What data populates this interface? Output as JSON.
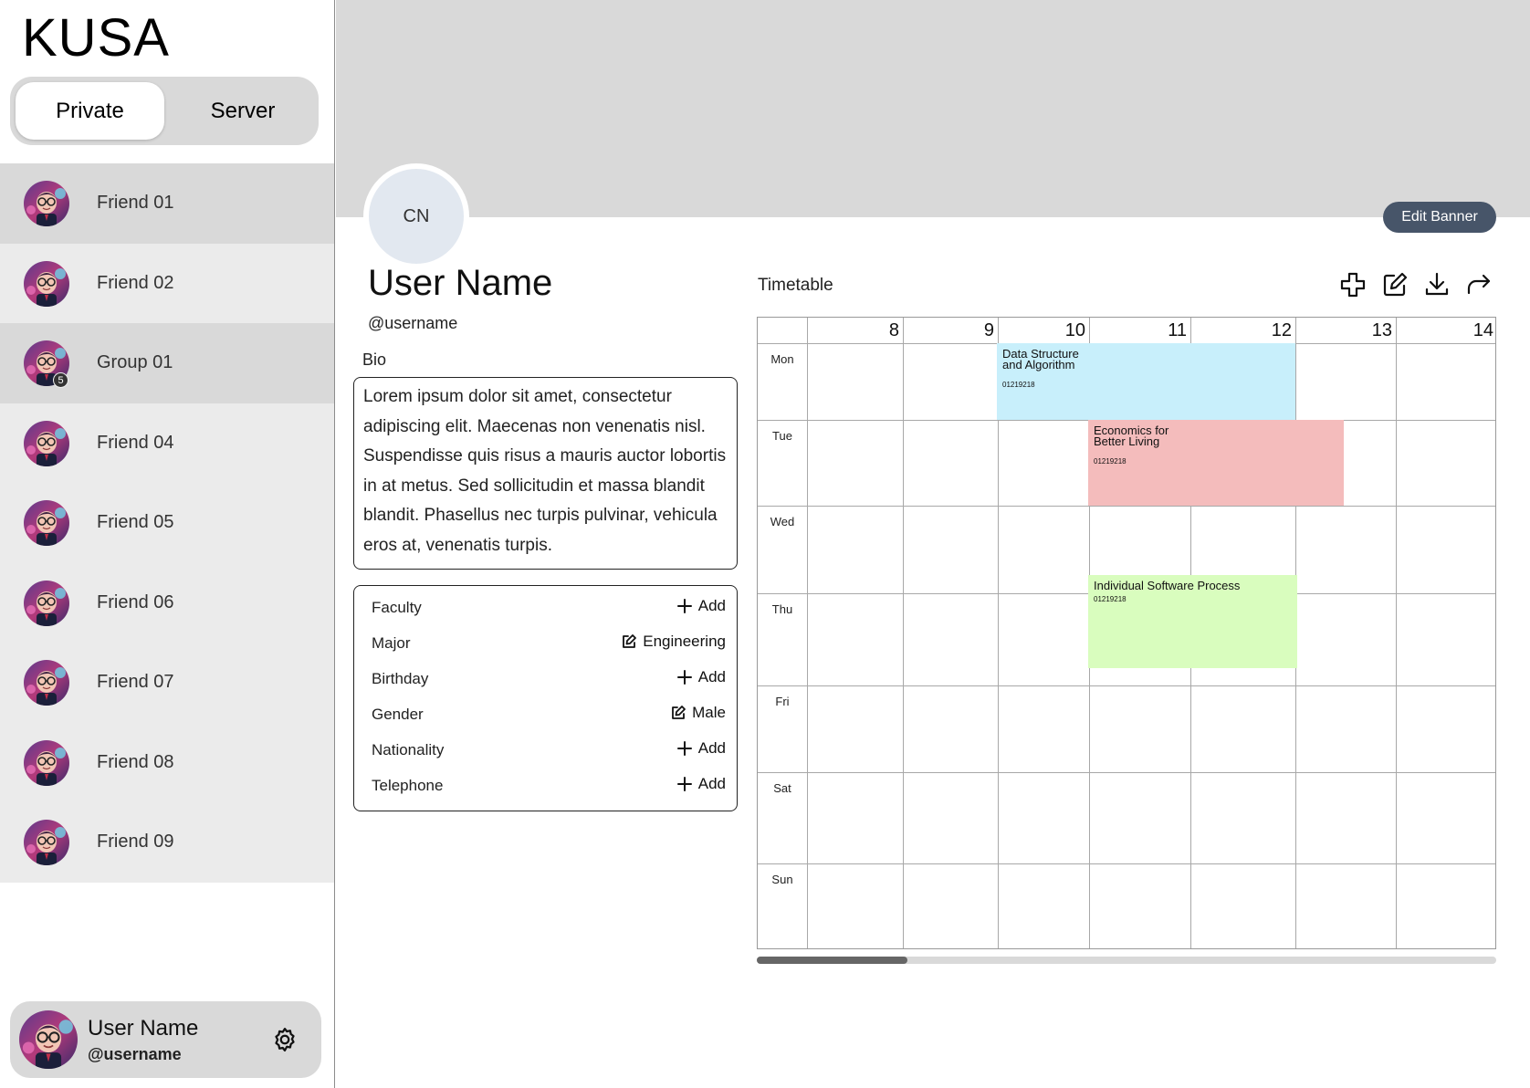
{
  "app": {
    "logo": "KUSA"
  },
  "segments": {
    "private": "Private",
    "server": "Server"
  },
  "friends": [
    {
      "name": "Friend 01"
    },
    {
      "name": "Friend 02"
    },
    {
      "name": "Group 01",
      "badge": "5"
    },
    {
      "name": "Friend 04"
    },
    {
      "name": "Friend 05"
    },
    {
      "name": "Friend 06"
    },
    {
      "name": "Friend 07"
    },
    {
      "name": "Friend 08"
    },
    {
      "name": "Friend 09"
    }
  ],
  "current_user": {
    "name": "User Name",
    "username": "@username"
  },
  "banner": {
    "edit_label": "Edit Banner"
  },
  "profile": {
    "initials": "CN",
    "name": "User Name",
    "username": "@username",
    "bio_label": "Bio",
    "bio": "Lorem ipsum dolor sit amet, consectetur adipiscing elit. Maecenas non venenatis nisl. Suspendisse quis risus a mauris auctor lobortis in at metus. Sed sollicitudin et massa blandit blandit. Phasellus nec turpis pulvinar, vehicula eros at, venenatis turpis."
  },
  "info": [
    {
      "label": "Faculty",
      "action": "Add",
      "icon": "plus-icon"
    },
    {
      "label": "Major",
      "action": "Engineering",
      "icon": "edit-icon"
    },
    {
      "label": "Birthday",
      "action": "Add",
      "icon": "plus-icon"
    },
    {
      "label": "Gender",
      "action": "Male",
      "icon": "edit-icon"
    },
    {
      "label": "Nationality",
      "action": "Add",
      "icon": "plus-icon"
    },
    {
      "label": "Telephone",
      "action": "Add",
      "icon": "plus-icon"
    }
  ],
  "timetable": {
    "title": "Timetable",
    "tools": [
      "add-icon",
      "edit-icon",
      "download-icon",
      "share-icon"
    ],
    "hours": [
      "8",
      "9",
      "10",
      "11",
      "12",
      "13",
      "14"
    ],
    "days": [
      "Mon",
      "Tue",
      "Wed",
      "Thu",
      "Fri",
      "Sat",
      "Sun"
    ],
    "courses": [
      {
        "name": "Data Structure and Algorithm",
        "code": "01219218",
        "day": "Mon",
        "color": "#c8effb"
      },
      {
        "name": "Economics for Better Living",
        "code": "01219218",
        "day": "Tue",
        "color": "#f4bcbc"
      },
      {
        "name": "Individual Software Process",
        "code": "01219218",
        "day": "Thu",
        "color": "#d9fdbe"
      }
    ]
  },
  "colors": {
    "sidebar_item": "#ebebeb",
    "sidebar_active": "#d9d9d9",
    "banner": "#d9d9d9",
    "edit_banner_bg": "#475569",
    "avatar_bg": "#e2e8f0"
  }
}
